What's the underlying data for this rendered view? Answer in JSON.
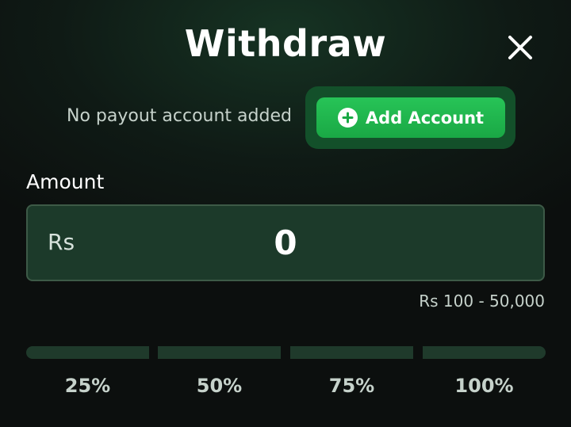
{
  "header": {
    "title": "Withdraw",
    "close_icon": "close-icon"
  },
  "payout": {
    "status_text": "No payout account added",
    "add_button_label": "Add Account",
    "add_icon": "plus-circle-icon"
  },
  "amount": {
    "label": "Amount",
    "currency": "Rs",
    "value": "0",
    "range_text": "Rs 100 - 50,000"
  },
  "quick_select": [
    {
      "label": "25%"
    },
    {
      "label": "50%"
    },
    {
      "label": "75%"
    },
    {
      "label": "100%"
    }
  ],
  "colors": {
    "accent_green": "#1fb34d",
    "background": "#0f1a15",
    "input_bg": "#1c3a2a"
  }
}
